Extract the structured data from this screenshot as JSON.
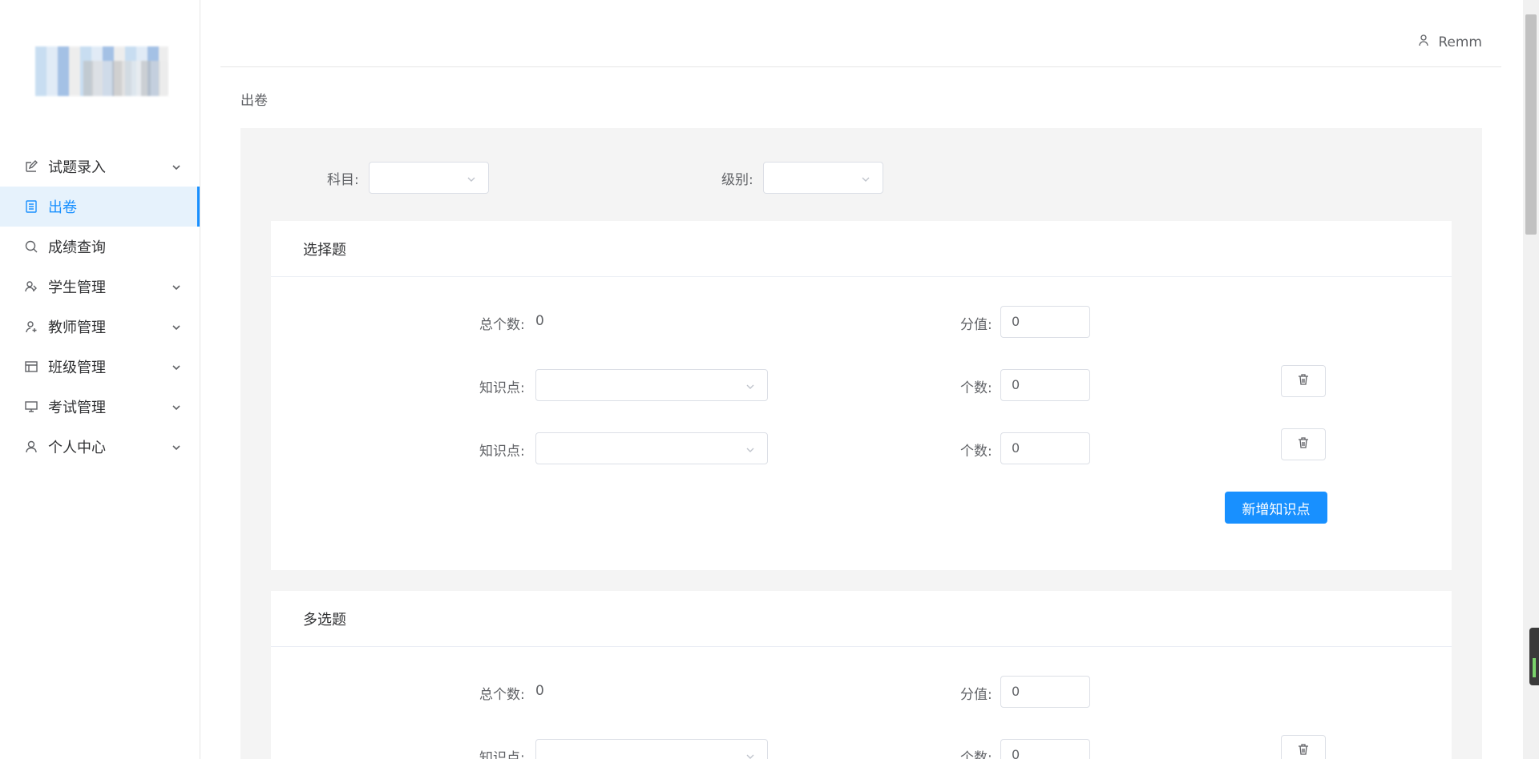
{
  "sidebar": {
    "items": [
      {
        "label": "试题录入",
        "icon": "edit-icon",
        "has_children": true,
        "active": false
      },
      {
        "label": "出卷",
        "icon": "document-icon",
        "has_children": false,
        "active": true
      },
      {
        "label": "成绩查询",
        "icon": "search-icon",
        "has_children": false,
        "active": false
      },
      {
        "label": "学生管理",
        "icon": "students-icon",
        "has_children": true,
        "active": false
      },
      {
        "label": "教师管理",
        "icon": "teacher-icon",
        "has_children": true,
        "active": false
      },
      {
        "label": "班级管理",
        "icon": "class-table-icon",
        "has_children": true,
        "active": false
      },
      {
        "label": "考试管理",
        "icon": "monitor-icon",
        "has_children": true,
        "active": false
      },
      {
        "label": "个人中心",
        "icon": "user-icon",
        "has_children": true,
        "active": false
      }
    ]
  },
  "header": {
    "username": "Remm"
  },
  "page": {
    "title": "出卷"
  },
  "filters": {
    "subject_label": "科目:",
    "subject_value": "",
    "level_label": "级别:",
    "level_value": ""
  },
  "sections": [
    {
      "title": "选择题",
      "total_label": "总个数:",
      "total_value": "0",
      "score_label": "分值:",
      "score_value": "0",
      "knowledge_label": "知识点:",
      "count_label": "个数:",
      "rows": [
        {
          "knowledge": "",
          "count": "0"
        },
        {
          "knowledge": "",
          "count": "0"
        }
      ],
      "add_button": "新增知识点"
    },
    {
      "title": "多选题",
      "total_label": "总个数:",
      "total_value": "0",
      "score_label": "分值:",
      "score_value": "0",
      "knowledge_label": "知识点:",
      "count_label": "个数:",
      "rows": [
        {
          "knowledge": "",
          "count": "0"
        }
      ]
    }
  ],
  "colors": {
    "primary": "#1890ff",
    "active_bg": "#e6f2fc",
    "content_bg": "#f4f4f4"
  }
}
